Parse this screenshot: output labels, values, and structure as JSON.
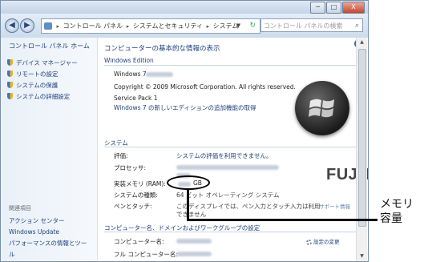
{
  "window": {
    "controls": {
      "minimize": "─",
      "maximize": "□",
      "close": "X"
    }
  },
  "nav": {
    "back_glyph": "◀",
    "forward_glyph": "▶",
    "address": [
      "コントロール パネル",
      "システムとセキュリティ",
      "システム"
    ],
    "search_placeholder": "コントロール パネルの検索"
  },
  "sidebar": {
    "home": "コントロール パネル ホーム",
    "links": [
      "デバイス マネージャー",
      "リモートの設定",
      "システムの保護",
      "システムの詳細設定"
    ],
    "related_title": "関連項目",
    "related": [
      "アクション センター",
      "Windows Update",
      "パフォーマンスの情報とツール"
    ]
  },
  "main": {
    "heading": "コンピューターの基本的な情報の表示",
    "edition": {
      "title": "Windows Edition",
      "product": "Windows 7",
      "copyright": "Copyright © 2009 Microsoft Corporation.  All rights reserved.",
      "service_pack": "Service Pack 1",
      "upgrade_link": "Windows 7 の新しいエディションの追加機能の取得"
    },
    "system": {
      "title": "システム",
      "rating_label": "評価:",
      "rating_value": "システムの評価を利用できません。",
      "processor_label": "プロセッサ:",
      "ram_label": "実装メモリ (RAM):",
      "ram_value": "GB",
      "type_label": "システムの種類:",
      "type_value": "64 ビット オペレーティング システム",
      "pen_label": "ペンとタッチ:",
      "pen_value_1": "このディスプレイでは、ペン入力とタッチ入力は利用",
      "pen_value_2": "できません",
      "support_link": "サポート情報"
    },
    "domain": {
      "title": "コンピューター名、ドメインおよびワークグループの設定",
      "computer_name_label": "コンピューター名:",
      "full_name_label": "フル コンピューター名:",
      "change_link": "設定の変更"
    },
    "oem_logo": "FUJITSU"
  },
  "annotation": {
    "line1": "メモリ",
    "line2": "容量"
  }
}
